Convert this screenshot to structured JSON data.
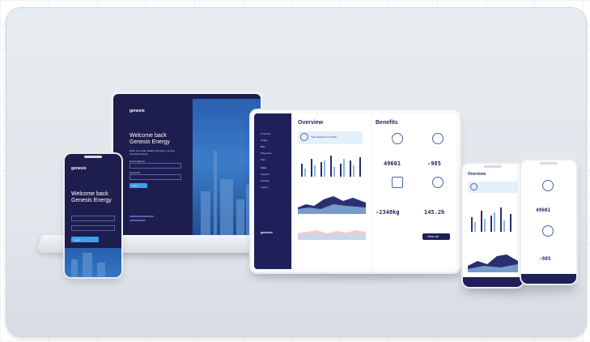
{
  "laptop": {
    "brand": "genesis",
    "headline": "Welcome back\nGenesis Energy",
    "sub": "Enter your login details and sign in to your Genesis account.",
    "email_label": "Email address",
    "password_label": "Password",
    "login_label": "Log in"
  },
  "tablet": {
    "overview_title": "Overview",
    "benefits_title": "Benefits",
    "nav": [
      "Overview",
      "Usage",
      "Bills",
      "Payments",
      "Plan",
      "Solar",
      "Support",
      "Settings",
      "Logout"
    ],
    "brand": "genesis",
    "chip_text": "Your account is in credit",
    "stat_values": [
      "49601",
      "-985",
      "-2348kg",
      "145.2h"
    ],
    "cta": "View all"
  },
  "phone_left": {
    "brand": "genesis",
    "headline": "Welcome back\nGenesis Energy",
    "login_label": "Log in"
  },
  "phone_mid": {
    "title": "Overview"
  },
  "phone_right": {
    "values": [
      "49601",
      "-985"
    ]
  },
  "colors": {
    "navy": "#1d1e4d",
    "accent": "#3aa0e8",
    "bg": "#e3e8ec"
  }
}
